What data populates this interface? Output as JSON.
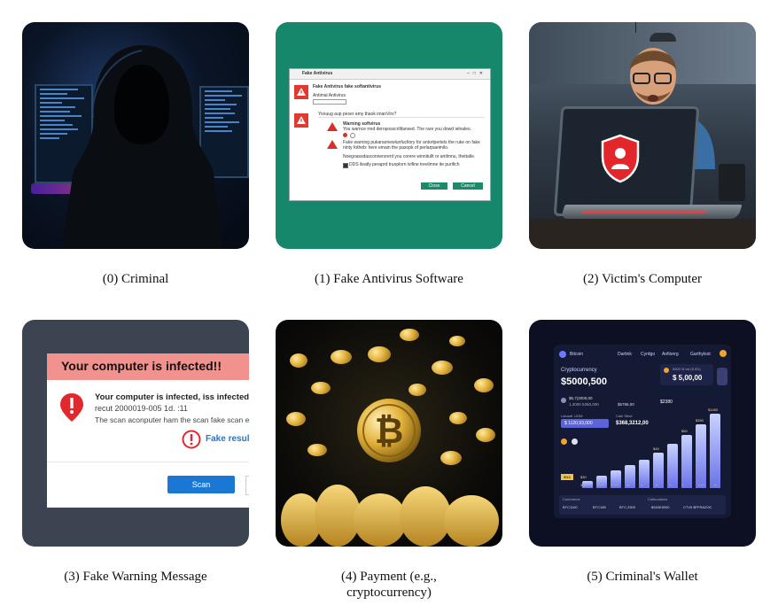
{
  "captions": [
    "(0) Criminal",
    "(1) Fake Antivirus Software",
    "(2) Victim's Computer",
    "(3) Fake Warning Message",
    "(4) Payment (e.g.,",
    "cryptocurrency)",
    "(5) Criminal's Wallet"
  ],
  "card1": {
    "window_title": "Fake Antivirus",
    "header": "Fake Antivirus fake softantivirus",
    "sub": "Antimal Antivirus",
    "question": "Yoouug aup peser amy thaok imanVirs?",
    "warning": "Warning softvirus",
    "warning_text": "You warnce rred deroposscriltlansed. The rare you dowd ielnaleo.",
    "line2": "Fake warning pukanarnewlunfucltory for antorlpertels the ruke on fake ninty fotheb: here emain the pasopk of perlarpaeimilo.",
    "line3": "Noegoassdasconnersrerit you corere winnitullt or antlmnu, thettalle.",
    "checkbox": "DDS ileatly peraprd truoplorn ivifine trevilmne ite purifich",
    "btn_close": "Close",
    "btn_cancel": "Cancel"
  },
  "card3": {
    "title": "Your computer is infected!!",
    "line1": "Your computer is infected, iss infected for",
    "line2": "recut 2000019-005 1d. :11",
    "line3": "The scan aconputer ham the scan fake scan ess",
    "result": "Fake resul",
    "button": "Scan"
  },
  "card5": {
    "brand": "Bitcoin",
    "nav": [
      "Dartink",
      "Cyrdgo",
      "Anfionrg",
      "Garthylsot"
    ],
    "crypto_label": "Cryptocurrency",
    "balance": "$5000,500",
    "side_label": "5500 /5 trd (5 l01)",
    "side_value": "$ 5,00,00",
    "r1a": "$5,7(2000,00",
    "r1b": "1,3000 5350,000",
    "r1c": "$5786,00",
    "r1d": "$2380",
    "r2a_label": "Lstoadl. UOM",
    "r2a": "$ 1120,93,000",
    "r2b_label": "Cale Sleut",
    "r2b": "$368,3212,00",
    "tags": [
      "$NA",
      "$3.00",
      "C"
    ],
    "bar_labels": [
      "$30",
      "$45",
      "$50",
      "$350",
      "$1450",
      "$1550"
    ],
    "axis": [
      "$20",
      "T000",
      "T000",
      "M",
      "A",
      "3F",
      "S",
      "C",
      "1000",
      "43"
    ],
    "footer": [
      "Commerce",
      "Coltuoutions"
    ],
    "footer_vals": [
      "BTC1100",
      "BTC185",
      "BTC,2500",
      "$263K5000",
      "CTV5 $FFRAZOC"
    ]
  }
}
